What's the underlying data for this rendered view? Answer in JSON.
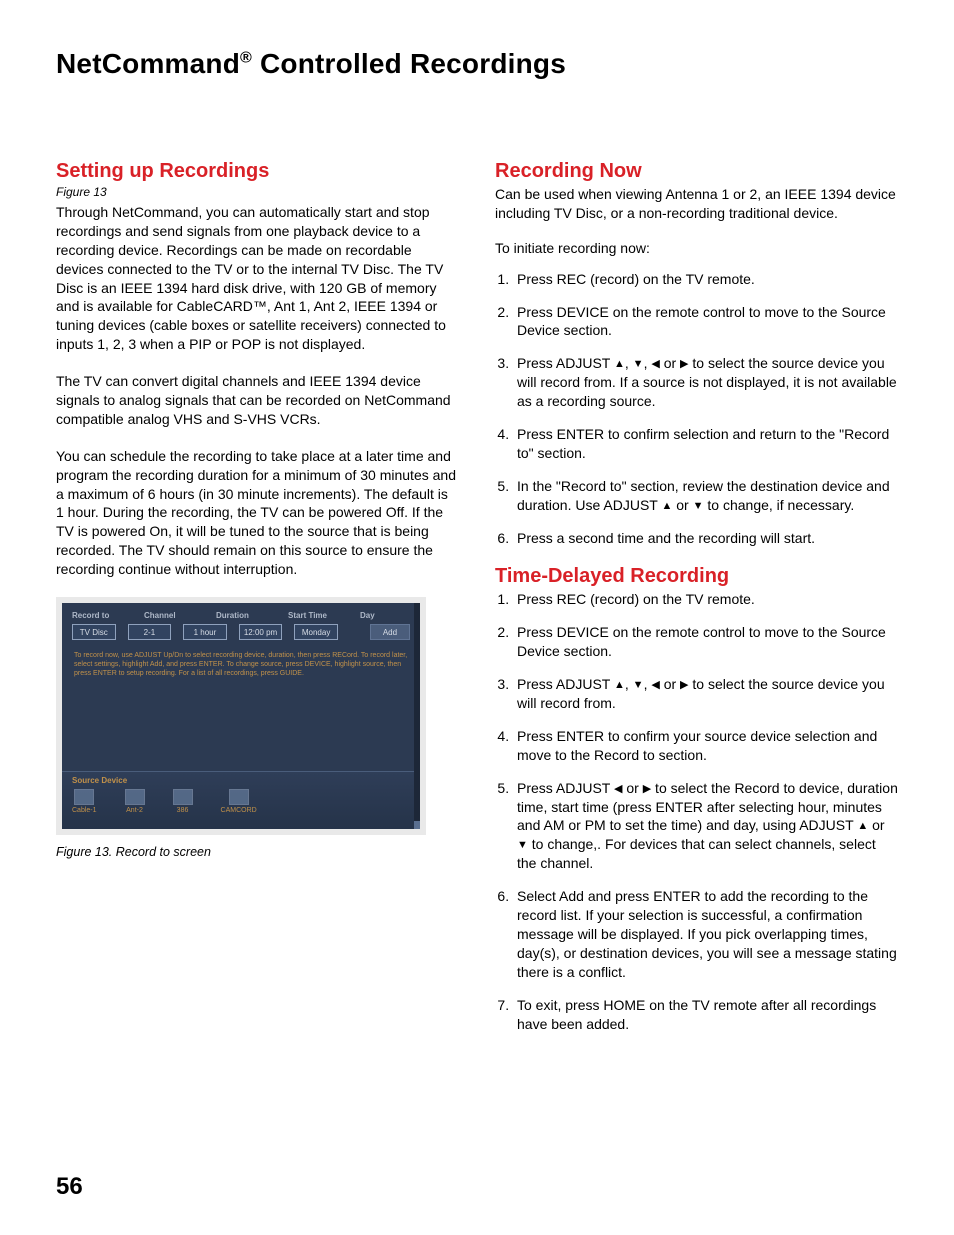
{
  "pageTitle": {
    "prefix": "NetCommand",
    "reg": "®",
    "suffix": " Controlled Recordings"
  },
  "pageNumber": "56",
  "arrows": {
    "up": "▲",
    "down": "▼",
    "left": "◀",
    "right": "▶"
  },
  "left": {
    "heading": "Setting up Recordings",
    "figRef": "Figure 13",
    "p1": "Through NetCommand, you can automatically start and stop recordings and send signals from one playback device to a recording device.  Recordings can be made on recordable devices connected to the TV or to the internal TV Disc.  The TV Disc is an IEEE 1394 hard disk drive, with 120 GB of memory and is available for CableCARD™, Ant 1, Ant 2, IEEE 1394 or tuning devices (cable boxes or satellite receivers) connected to inputs 1, 2, 3 when a PIP or POP is not displayed.",
    "p2": "The TV can convert digital channels and IEEE 1394 device signals to analog signals that can be recorded on NetCommand compatible analog VHS and S-VHS VCRs.",
    "p3": "You can schedule the recording to take place at a later time and program the recording duration for a minimum of 30 minutes and a maximum of 6 hours (in 30 minute increments).  The default is 1 hour.  During the recording, the TV can be powered Off.  If the TV is powered On, it will be tuned to the source that is being recorded.  The TV should remain on this source to ensure the recording continue without interruption.",
    "figure": {
      "headers": {
        "h1": "Record to",
        "h2": "Channel",
        "h3": "Duration",
        "h4": "Start Time",
        "h5": "Day"
      },
      "values": {
        "v1": "TV Disc",
        "v2": "2-1",
        "v3": "1 hour",
        "v4": "12:00 pm",
        "v5": "Monday",
        "add": "Add"
      },
      "note": "To record now, use ADJUST Up/Dn to select recording device, duration, then press RECord.  To record later, select settings, highlight Add, and press ENTER.  To change source, press DEVICE, highlight source, then press ENTER to setup recording.  For a list of all recordings, press GUIDE.",
      "bottomTitle": "Source Device",
      "devs": {
        "d1": "Cable-1",
        "d2": "Ant-2",
        "d3": "386",
        "d4": "CAMCORD"
      }
    },
    "caption": "Figure 13. Record to screen"
  },
  "right": {
    "now": {
      "heading": "Recording Now",
      "intro": "Can be used when viewing Antenna 1 or 2, an IEEE 1394 device including TV Disc, or a non-recording traditional device.",
      "lead": "To initiate recording now:",
      "steps": {
        "s1": "Press REC (record) on the TV remote.",
        "s2": "Press DEVICE on the remote control to move to the Source Device section.",
        "s3a": "Press ADJUST ",
        "s3b": " to select the source device you will record from.  If a source is not displayed, it is not available as a recording source.",
        "s4": "Press ENTER to confirm selection and return to the \"Record to\" section.",
        "s5a": "In the \"Record to\" section, review the destination device and duration.  Use ADJUST ",
        "s5b": " to change, if necessary.",
        "s6": "Press a second time and the recording will start."
      }
    },
    "delayed": {
      "heading": "Time-Delayed Recording",
      "steps": {
        "s1": "Press REC (record) on the TV remote.",
        "s2": "Press DEVICE on the remote control to move to the Source Device section.",
        "s3a": "Press ADJUST ",
        "s3b": " to select the source device you will record from.",
        "s4": "Press ENTER to confirm your source device selection and move to the Record to section.",
        "s5a": "Press ADJUST ",
        "s5b": " to select the Record to device, duration time, start time (press ENTER after selecting hour, minutes and AM or PM to set the time) and day, using ADJUST ",
        "s5c": " to change,.  For devices that can select channels, select the channel.",
        "s6": "Select Add and press ENTER to add the recording to the record list.  If your selection is successful, a confirmation message will be displayed.  If you pick overlapping times, day(s), or destination devices, you will see a message stating there is a conflict.",
        "s7": "To exit, press HOME on the TV remote after all recordings have been added."
      }
    }
  }
}
